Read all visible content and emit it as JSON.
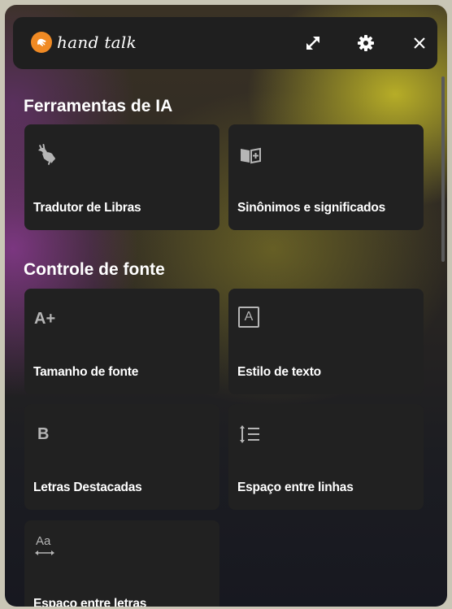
{
  "brand": {
    "name": "hand talk",
    "accent": "#f08a24"
  },
  "header": {
    "expand_icon": "expand-arrows-icon",
    "settings_icon": "gear-icon",
    "close_icon": "close-icon"
  },
  "sections": {
    "ai_tools": {
      "title": "Ferramentas de IA",
      "cards": [
        {
          "label": "Tradutor de Libras",
          "icon": "sign-language-hands-icon"
        },
        {
          "label": "Sinônimos e significados",
          "icon": "book-plus-icon"
        }
      ]
    },
    "font_control": {
      "title": "Controle de fonte",
      "cards": [
        {
          "label": "Tamanho de fonte",
          "icon": "font-size-increase-icon",
          "glyph": "A+"
        },
        {
          "label": "Estilo de texto",
          "icon": "text-style-icon",
          "glyph": "A"
        },
        {
          "label": "Letras Destacadas",
          "icon": "bold-icon",
          "glyph": "B"
        },
        {
          "label": "Espaço entre linhas",
          "icon": "line-spacing-icon"
        },
        {
          "label": "Espaço entre letras",
          "icon": "letter-spacing-icon",
          "glyph": "Aa"
        }
      ]
    }
  }
}
